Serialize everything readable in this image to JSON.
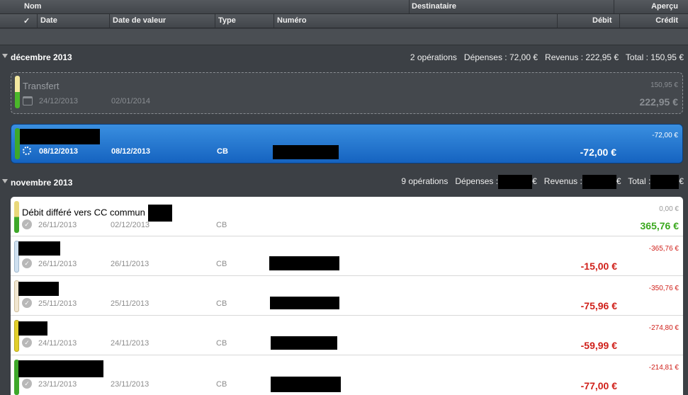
{
  "columns": {
    "nom": "Nom",
    "destinataire": "Destinataire",
    "apercu": "Aperçu",
    "check": "✓",
    "date": "Date",
    "date_valeur": "Date de valeur",
    "type": "Type",
    "numero": "Numéro",
    "debit": "Débit",
    "credit": "Crédit"
  },
  "groups": {
    "dec": {
      "title": "décembre 2013",
      "operations": "2 opérations",
      "depenses_label": "Dépenses :",
      "depenses": "72,00 €",
      "revenus_label": "Revenus :",
      "revenus": "222,95 €",
      "total_label": "Total :",
      "total": "150,95 €"
    },
    "nov": {
      "title": "novembre 2013",
      "operations": "9 opérations",
      "depenses_label": "Dépenses :",
      "revenus_label": "Revenus :",
      "total_label": "Total :",
      "currency": "€"
    }
  },
  "transactions": {
    "pending": {
      "name": "Transfert",
      "date": "24/12/2013",
      "date_valeur": "02/01/2014",
      "balance": "150,95 €",
      "amount": "222,95 €"
    },
    "selected": {
      "date": "08/12/2013",
      "date_valeur": "08/12/2013",
      "type": "CB",
      "balance": "-72,00 €",
      "amount": "-72,00 €"
    },
    "rows": [
      {
        "name": "Débit différé vers CC commun",
        "date": "26/11/2013",
        "date_valeur": "02/12/2013",
        "type": "CB",
        "balance": "0,00 €",
        "amount": "365,76 €"
      },
      {
        "date": "26/11/2013",
        "date_valeur": "26/11/2013",
        "type": "CB",
        "balance": "-365,76 €",
        "amount": "-15,00 €"
      },
      {
        "date": "25/11/2013",
        "date_valeur": "25/11/2013",
        "type": "CB",
        "balance": "-350,76 €",
        "amount": "-75,96 €"
      },
      {
        "date": "24/11/2013",
        "date_valeur": "24/11/2013",
        "type": "CB",
        "balance": "-274,80 €",
        "amount": "-59,99 €"
      },
      {
        "date": "23/11/2013",
        "date_valeur": "23/11/2013",
        "type": "CB",
        "balance": "-214,81 €",
        "amount": "-77,00 €"
      }
    ]
  },
  "colors": {
    "credit_green": "#3aa81e",
    "debit_red": "#d0201a",
    "selection_blue": "#1a6fd0"
  },
  "icons": {
    "status": "check-circle-icon",
    "scheduled": "calendar-icon",
    "processing": "spinner-icon",
    "group": "disclosure-triangle-icon"
  }
}
